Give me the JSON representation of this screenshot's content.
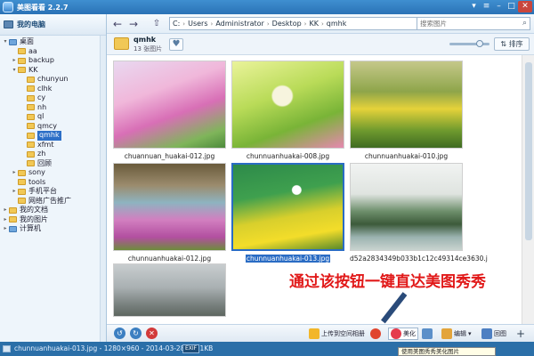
{
  "window": {
    "title": "美图看看 2.2.7"
  },
  "sidebar": {
    "header": "我的电脑",
    "tree": [
      {
        "label": "桌面",
        "level": 0,
        "twisty": "▾",
        "color": "blue"
      },
      {
        "label": "aa",
        "level": 1,
        "twisty": "",
        "color": "yellow"
      },
      {
        "label": "backup",
        "level": 1,
        "twisty": "▸",
        "color": "yellow"
      },
      {
        "label": "KK",
        "level": 1,
        "twisty": "▾",
        "color": "yellow"
      },
      {
        "label": "chunyun",
        "level": 2,
        "twisty": "",
        "color": "yellow"
      },
      {
        "label": "clhk",
        "level": 2,
        "twisty": "",
        "color": "yellow"
      },
      {
        "label": "cy",
        "level": 2,
        "twisty": "",
        "color": "yellow"
      },
      {
        "label": "nh",
        "level": 2,
        "twisty": "",
        "color": "yellow"
      },
      {
        "label": "ql",
        "level": 2,
        "twisty": "",
        "color": "yellow"
      },
      {
        "label": "qmcy",
        "level": 2,
        "twisty": "",
        "color": "yellow"
      },
      {
        "label": "qmhk",
        "level": 2,
        "twisty": "",
        "color": "yellow",
        "selected": true
      },
      {
        "label": "xfmt",
        "level": 2,
        "twisty": "",
        "color": "yellow"
      },
      {
        "label": "zh",
        "level": 2,
        "twisty": "",
        "color": "yellow"
      },
      {
        "label": "回顾",
        "level": 2,
        "twisty": "",
        "color": "yellow"
      },
      {
        "label": "sony",
        "level": 1,
        "twisty": "▸",
        "color": "yellow"
      },
      {
        "label": "tools",
        "level": 1,
        "twisty": "",
        "color": "yellow"
      },
      {
        "label": "手机平台",
        "level": 1,
        "twisty": "▸",
        "color": "yellow"
      },
      {
        "label": "网络广告推广",
        "level": 1,
        "twisty": "",
        "color": "yellow"
      },
      {
        "label": "我的文档",
        "level": 0,
        "twisty": "▸",
        "color": "yellow"
      },
      {
        "label": "我的图片",
        "level": 0,
        "twisty": "▸",
        "color": "yellow"
      },
      {
        "label": "计算机",
        "level": 0,
        "twisty": "▸",
        "color": "blue"
      }
    ]
  },
  "toolbar": {
    "path": [
      "C:",
      "Users",
      "Administrator",
      "Desktop",
      "KK",
      "qmhk"
    ],
    "search_placeholder": "搜索图片"
  },
  "folder": {
    "name": "qmhk",
    "count": "13 张图片",
    "sort_label": "排序"
  },
  "thumbnails": [
    {
      "caption": "chuannuan_huakai-012.jpg",
      "selected": false,
      "bg": "linear-gradient(160deg,#e9d8f0 0%,#f0b7da 35%,#d86fb6 60%,#7fb55a 85%,#4d8a3c 100%)"
    },
    {
      "caption": "chunnuanhuakai-008.jpg",
      "selected": false,
      "bg": "radial-gradient(circle at 45% 40%,#f7f4de 0 12%,transparent 14%), linear-gradient(160deg,#eaf39a 0%,#b9db58 40%,#79b437 70%,#e688b0 100%)"
    },
    {
      "caption": "chunnuanhuakai-010.jpg",
      "selected": false,
      "bg": "linear-gradient(180deg,#c5c88a 0%,#8ea54a 35%,#e5d23a 55%,#6f9a2e 80%,#3f6b22 100%)"
    },
    {
      "caption": "chunnuanhuakai-012.jpg",
      "selected": false,
      "bg": "linear-gradient(180deg,#6a5b3c 0%,#9b8c6d 25%,#8eb3c0 45%,#d27fc0 65%,#b24fa0 85%,#6d8c3a 100%)"
    },
    {
      "caption": "chunnuanhuakai-013.jpg",
      "selected": true,
      "bg": "radial-gradient(circle at 58% 30%,#ffffff 0 5%,transparent 6%), linear-gradient(170deg,#2d8a4a 0%,#3fa04e 35%,#d8cf2c 60%,#f3dd2a 80%,#5a8a2a 100%)"
    },
    {
      "caption": "d52a2834349b033b1c12c49314ce3630.j",
      "selected": false,
      "bg": "linear-gradient(180deg,#f1f3f2 0%,#dfe4e0 35%,#6e8f6c 55%,#3c5a3a 70%,#9bb3b0 85%,#c9d3cf 100%)"
    },
    {
      "caption": "",
      "selected": false,
      "bg": "linear-gradient(180deg,#c8cdcf 0%,#a9b0b2 45%,#7d8583 75%,#5d6660 100%)"
    }
  ],
  "promo_text": "通过该按钮一键直达美图秀秀",
  "bottom": {
    "upload_label": "上传到空间相册",
    "beautify_label": "美化",
    "edit_label": "编辑",
    "view_label": "回图"
  },
  "status": {
    "text": "chunnuanhuakai-013.jpg - 1280×960 - 2014-03-28 - 191KB",
    "exif": "EXIF",
    "tooltip": "使用美图秀秀美化图片"
  }
}
